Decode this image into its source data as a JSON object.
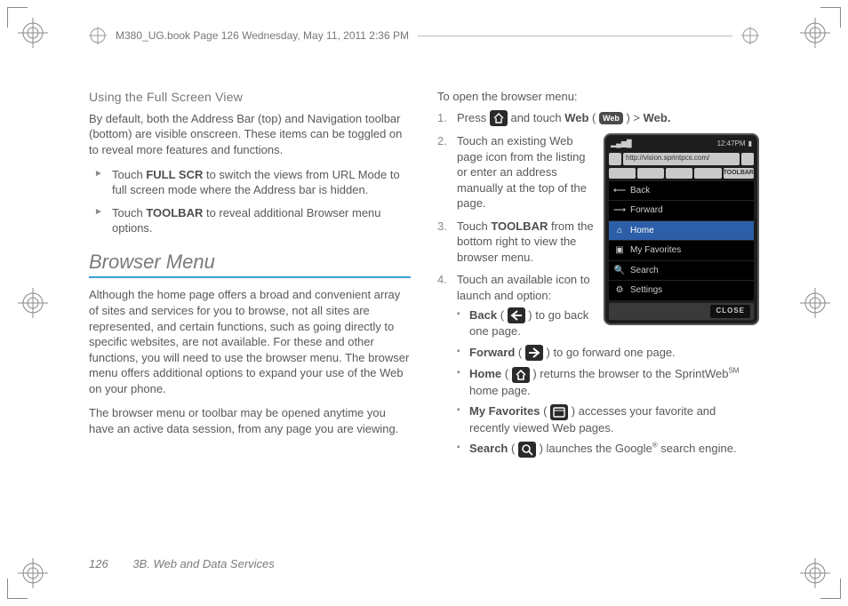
{
  "header": {
    "text": "M380_UG.book  Page 126  Wednesday, May 11, 2011  2:36 PM"
  },
  "footer": {
    "page": "126",
    "section": "3B. Web and Data Services"
  },
  "left": {
    "h_fullscreen": "Using the Full Screen View",
    "p1": "By default, both the Address Bar (top) and Navigation toolbar (bottom) are visible onscreen. These items can be toggled on to reveal more features and functions.",
    "b1_a": "Touch ",
    "b1_b": "FULL SCR",
    "b1_c": " to switch the views from URL Mode to full screen mode where the Address bar is hidden.",
    "b2_a": "Touch ",
    "b2_b": "TOOLBAR",
    "b2_c": " to reveal additional Browser menu options.",
    "h_menu": "Browser Menu",
    "p2": "Although the home page offers a broad and convenient array of sites and services for you to browse, not all sites are represented, and certain functions, such as going directly to specific websites, are not available. For these and other functions, you will need to use the browser menu. The browser menu offers additional options to expand your use of the Web on your phone.",
    "p3": "The browser menu or toolbar may be opened anytime you have an active data session, from any page you are viewing."
  },
  "right": {
    "lead": "To open the browser menu:",
    "s1_a": "Press ",
    "s1_b": " and touch ",
    "s1_web": "Web",
    "s1_c": " (",
    "s1_chip": "Web",
    "s1_d": ") > ",
    "s1_e": "Web.",
    "s2": "Touch an existing Web page  icon from the listing or enter an address manually at the top of the page.",
    "s3_a": "Touch ",
    "s3_b": "TOOLBAR",
    "s3_c": " from the bottom right to view the browser menu.",
    "s4": "Touch an available icon to launch and option:",
    "o_back_b": "Back",
    "o_back_a": " (",
    "o_back_c": ") to go back one page.",
    "o_fwd_b": "Forward",
    "o_fwd_a": " (",
    "o_fwd_c": ") to go forward one page.",
    "o_home_b": "Home",
    "o_home_a": " (",
    "o_home_c": ") returns the browser to the SprintWeb",
    "o_home_sm": "SM",
    "o_home_d": " home page.",
    "o_fav_b": "My Favorites",
    "o_fav_a": " (",
    "o_fav_c": ") accesses your favorite and recently viewed Web pages.",
    "o_src_b": "Search",
    "o_src_a": " (",
    "o_src_c": ") launches the Google",
    "o_src_sm": "®",
    "o_src_d": " search engine."
  },
  "device": {
    "time": "12:47PM",
    "url": "http://vision.sprintpcs.com/",
    "toolbar_last": "TOOLBAR",
    "menu": {
      "back": "Back",
      "forward": "Forward",
      "home": "Home",
      "fav": "My Favorites",
      "search": "Search",
      "settings": "Settings"
    },
    "close": "CLOSE"
  }
}
